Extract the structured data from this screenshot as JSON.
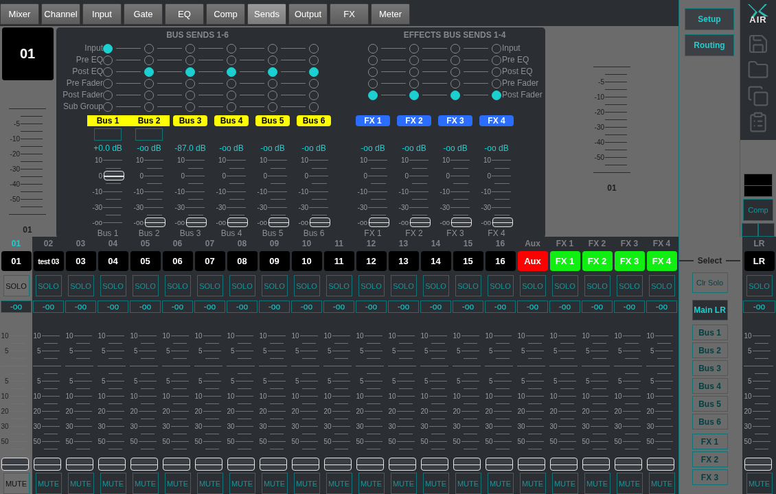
{
  "tabs": [
    {
      "label": "Mixer",
      "selected": false
    },
    {
      "label": "Channel",
      "selected": false
    },
    {
      "label": "Input",
      "selected": false
    },
    {
      "label": "Gate",
      "selected": false
    },
    {
      "label": "EQ",
      "selected": false
    },
    {
      "label": "Comp",
      "selected": false
    },
    {
      "label": "Sends",
      "selected": true
    },
    {
      "label": "Output",
      "selected": false
    },
    {
      "label": "FX",
      "selected": false
    },
    {
      "label": "Meter",
      "selected": false
    }
  ],
  "channel_header": {
    "name": "01",
    "scale": [
      "-5",
      "-10",
      "-20",
      "-30",
      "-40",
      "-50"
    ],
    "label": "01"
  },
  "bus_sends": {
    "title": "BUS SENDS 1-6",
    "tap_labels": [
      "Input",
      "Pre EQ",
      "Post EQ",
      "Pre Fader",
      "Post Fader",
      "Sub Group"
    ],
    "buses": [
      {
        "name": "Bus 1",
        "color": "#ffff00",
        "linked": true,
        "taps": [
          {
            "selected": true
          },
          {
            "selected": false
          },
          {
            "selected": false
          },
          {
            "selected": false
          },
          {
            "selected": false
          },
          {
            "selected": false
          }
        ],
        "reading": "+0.0 dB",
        "scale": [
          "10",
          "0",
          "-10",
          "-30",
          "-oo"
        ],
        "level": 0.76,
        "footer": "Bus 1"
      },
      {
        "name": "Bus 2",
        "color": "#ffff00",
        "linked": true,
        "taps": [
          {
            "selected": false
          },
          {
            "selected": false
          },
          {
            "selected": true
          },
          {
            "selected": false
          },
          {
            "selected": false
          },
          {
            "selected": false
          }
        ],
        "reading": "-oo dB",
        "scale": [
          "10",
          "0",
          "-10",
          "-30",
          "-oo"
        ],
        "level": 0,
        "footer": "Bus 2"
      },
      {
        "name": "Bus 3",
        "color": "#ffff00",
        "linked": false,
        "taps": [
          {
            "selected": false
          },
          {
            "selected": false
          },
          {
            "selected": true
          },
          {
            "selected": false
          },
          {
            "selected": false
          },
          {
            "selected": false
          }
        ],
        "reading": "-87.0 dB",
        "scale": [
          "10",
          "0",
          "-10",
          "-30",
          "-oo"
        ],
        "level": 0,
        "footer": "Bus 3"
      },
      {
        "name": "Bus 4",
        "color": "#ffff00",
        "linked": false,
        "taps": [
          {
            "selected": false
          },
          {
            "selected": false
          },
          {
            "selected": true
          },
          {
            "selected": false
          },
          {
            "selected": false
          },
          {
            "selected": false
          }
        ],
        "reading": "-oo dB",
        "scale": [
          "10",
          "0",
          "-10",
          "-30",
          "-oo"
        ],
        "level": 0,
        "footer": "Bus 4"
      },
      {
        "name": "Bus 5",
        "color": "#ffff00",
        "linked": false,
        "taps": [
          {
            "selected": false
          },
          {
            "selected": false
          },
          {
            "selected": true
          },
          {
            "selected": false
          },
          {
            "selected": false
          },
          {
            "selected": false
          }
        ],
        "reading": "-oo dB",
        "scale": [
          "10",
          "0",
          "-10",
          "-30",
          "-oo"
        ],
        "level": 0,
        "footer": "Bus 5"
      },
      {
        "name": "Bus 6",
        "color": "#ffff00",
        "linked": false,
        "taps": [
          {
            "selected": false
          },
          {
            "selected": false
          },
          {
            "selected": true
          },
          {
            "selected": false
          },
          {
            "selected": false
          },
          {
            "selected": false
          }
        ],
        "reading": "-oo dB",
        "scale": [
          "10",
          "0",
          "-10",
          "-30",
          "-oo"
        ],
        "level": 0,
        "footer": "Bus 6"
      }
    ]
  },
  "effects_sends": {
    "title": "EFFECTS BUS SENDS 1-4",
    "tap_labels": [
      "Input",
      "Pre EQ",
      "Post EQ",
      "Pre Fader",
      "Post Fader"
    ],
    "buses": [
      {
        "name": "FX 1",
        "color": "#2a6dff",
        "linked": false,
        "taps": [
          {
            "selected": false
          },
          {
            "selected": false
          },
          {
            "selected": false
          },
          {
            "selected": false
          },
          {
            "selected": true
          }
        ],
        "reading": "-oo dB",
        "scale": [
          "10",
          "0",
          "-10",
          "-30",
          "-oo"
        ],
        "level": 0,
        "footer": "FX 1"
      },
      {
        "name": "FX 2",
        "color": "#2a6dff",
        "linked": false,
        "taps": [
          {
            "selected": false
          },
          {
            "selected": false
          },
          {
            "selected": false
          },
          {
            "selected": false
          },
          {
            "selected": true
          }
        ],
        "reading": "-oo dB",
        "scale": [
          "10",
          "0",
          "-10",
          "-30",
          "-oo"
        ],
        "level": 0,
        "footer": "FX 2"
      },
      {
        "name": "FX 3",
        "color": "#2a6dff",
        "linked": false,
        "taps": [
          {
            "selected": false
          },
          {
            "selected": false
          },
          {
            "selected": false
          },
          {
            "selected": false
          },
          {
            "selected": true
          }
        ],
        "reading": "-oo dB",
        "scale": [
          "10",
          "0",
          "-10",
          "-30",
          "-oo"
        ],
        "level": 0,
        "footer": "FX 3"
      },
      {
        "name": "FX 4",
        "color": "#2a6dff",
        "linked": false,
        "taps": [
          {
            "selected": false
          },
          {
            "selected": false
          },
          {
            "selected": false
          },
          {
            "selected": false
          },
          {
            "selected": true
          }
        ],
        "reading": "-oo dB",
        "scale": [
          "10",
          "0",
          "-10",
          "-30",
          "-oo"
        ],
        "level": 0,
        "footer": "FX 4"
      }
    ]
  },
  "meter_panel": {
    "scale": [
      "-5",
      "-10",
      "-20",
      "-30",
      "-40",
      "-50"
    ],
    "label": "01"
  },
  "side_buttons": [
    "Setup",
    "Routing"
  ],
  "logo": "AIR",
  "comp_button": "Comp",
  "channels": [
    {
      "number": "01",
      "name": "01",
      "color": "#000000",
      "selected": true,
      "solo": "SOLO",
      "reading": "-oo",
      "scale": [
        "10",
        "5",
        "5",
        "10",
        "20",
        "30",
        "50"
      ],
      "level": 0,
      "mute": "MUTE"
    },
    {
      "number": "02",
      "name": "test 03",
      "color": "#000000",
      "selected": false,
      "solo": "SOLO",
      "reading": "-oo",
      "scale": [
        "10",
        "5",
        "5",
        "10",
        "20",
        "30",
        "50"
      ],
      "level": 0,
      "mute": "MUTE"
    },
    {
      "number": "03",
      "name": "03",
      "color": "#000000",
      "selected": false,
      "solo": "SOLO",
      "reading": "-oo",
      "scale": [
        "10",
        "5",
        "5",
        "10",
        "20",
        "30",
        "50"
      ],
      "level": 0,
      "mute": "MUTE"
    },
    {
      "number": "04",
      "name": "04",
      "color": "#000000",
      "selected": false,
      "solo": "SOLO",
      "reading": "-oo",
      "scale": [
        "10",
        "5",
        "5",
        "10",
        "20",
        "30",
        "50"
      ],
      "level": 0,
      "mute": "MUTE"
    },
    {
      "number": "05",
      "name": "05",
      "color": "#000000",
      "selected": false,
      "solo": "SOLO",
      "reading": "-oo",
      "scale": [
        "10",
        "5",
        "5",
        "10",
        "20",
        "30",
        "50"
      ],
      "level": 0,
      "mute": "MUTE"
    },
    {
      "number": "06",
      "name": "06",
      "color": "#000000",
      "selected": false,
      "solo": "SOLO",
      "reading": "-oo",
      "scale": [
        "10",
        "5",
        "5",
        "10",
        "20",
        "30",
        "50"
      ],
      "level": 0,
      "mute": "MUTE"
    },
    {
      "number": "07",
      "name": "07",
      "color": "#000000",
      "selected": false,
      "solo": "SOLO",
      "reading": "-oo",
      "scale": [
        "10",
        "5",
        "5",
        "10",
        "20",
        "30",
        "50"
      ],
      "level": 0,
      "mute": "MUTE"
    },
    {
      "number": "08",
      "name": "08",
      "color": "#000000",
      "selected": false,
      "solo": "SOLO",
      "reading": "-oo",
      "scale": [
        "10",
        "5",
        "5",
        "10",
        "20",
        "30",
        "50"
      ],
      "level": 0,
      "mute": "MUTE"
    },
    {
      "number": "09",
      "name": "09",
      "color": "#000000",
      "selected": false,
      "solo": "SOLO",
      "reading": "-oo",
      "scale": [
        "10",
        "5",
        "5",
        "10",
        "20",
        "30",
        "50"
      ],
      "level": 0,
      "mute": "MUTE"
    },
    {
      "number": "10",
      "name": "10",
      "color": "#000000",
      "selected": false,
      "solo": "SOLO",
      "reading": "-oo",
      "scale": [
        "10",
        "5",
        "5",
        "10",
        "20",
        "30",
        "50"
      ],
      "level": 0,
      "mute": "MUTE"
    },
    {
      "number": "11",
      "name": "11",
      "color": "#000000",
      "selected": false,
      "solo": "SOLO",
      "reading": "-oo",
      "scale": [
        "10",
        "5",
        "5",
        "10",
        "20",
        "30",
        "50"
      ],
      "level": 0,
      "mute": "MUTE"
    },
    {
      "number": "12",
      "name": "12",
      "color": "#000000",
      "selected": false,
      "solo": "SOLO",
      "reading": "-oo",
      "scale": [
        "10",
        "5",
        "5",
        "10",
        "20",
        "30",
        "50"
      ],
      "level": 0,
      "mute": "MUTE"
    },
    {
      "number": "13",
      "name": "13",
      "color": "#000000",
      "selected": false,
      "solo": "SOLO",
      "reading": "-oo",
      "scale": [
        "10",
        "5",
        "5",
        "10",
        "20",
        "30",
        "50"
      ],
      "level": 0,
      "mute": "MUTE"
    },
    {
      "number": "14",
      "name": "14",
      "color": "#000000",
      "selected": false,
      "solo": "SOLO",
      "reading": "-oo",
      "scale": [
        "10",
        "5",
        "5",
        "10",
        "20",
        "30",
        "50"
      ],
      "level": 0,
      "mute": "MUTE"
    },
    {
      "number": "15",
      "name": "15",
      "color": "#000000",
      "selected": false,
      "solo": "SOLO",
      "reading": "-oo",
      "scale": [
        "10",
        "5",
        "5",
        "10",
        "20",
        "30",
        "50"
      ],
      "level": 0,
      "mute": "MUTE"
    },
    {
      "number": "16",
      "name": "16",
      "color": "#000000",
      "selected": false,
      "solo": "SOLO",
      "reading": "-oo",
      "scale": [
        "10",
        "5",
        "5",
        "10",
        "20",
        "30",
        "50"
      ],
      "level": 0,
      "mute": "MUTE"
    },
    {
      "number": "Aux",
      "name": "Aux",
      "color": "#ff0000",
      "selected": false,
      "solo": "SOLO",
      "reading": "-oo",
      "scale": [
        "10",
        "5",
        "5",
        "10",
        "20",
        "30",
        "50"
      ],
      "level": 0,
      "mute": "MUTE"
    },
    {
      "number": "FX 1",
      "name": "FX 1",
      "color": "#11ee11",
      "selected": false,
      "solo": "SOLO",
      "reading": "-oo",
      "scale": [
        "10",
        "5",
        "5",
        "10",
        "20",
        "30",
        "50"
      ],
      "level": 0,
      "mute": "MUTE"
    },
    {
      "number": "FX 2",
      "name": "FX 2",
      "color": "#11ee11",
      "selected": false,
      "solo": "SOLO",
      "reading": "-oo",
      "scale": [
        "10",
        "5",
        "5",
        "10",
        "20",
        "30",
        "50"
      ],
      "level": 0,
      "mute": "MUTE"
    },
    {
      "number": "FX 3",
      "name": "FX 3",
      "color": "#11ee11",
      "selected": false,
      "solo": "SOLO",
      "reading": "-oo",
      "scale": [
        "10",
        "5",
        "5",
        "10",
        "20",
        "30",
        "50"
      ],
      "level": 0,
      "mute": "MUTE"
    },
    {
      "number": "FX 4",
      "name": "FX 4",
      "color": "#11ee11",
      "selected": false,
      "solo": "SOLO",
      "reading": "-oo",
      "scale": [
        "10",
        "5",
        "5",
        "10",
        "20",
        "30",
        "50"
      ],
      "level": 0,
      "mute": "MUTE"
    }
  ],
  "select_panel": {
    "title": "Select",
    "clear": "Clr Solo",
    "groups": [
      {
        "items": [
          {
            "label": "Main LR",
            "selected": true
          }
        ]
      },
      {
        "items": [
          {
            "label": "Bus 1",
            "selected": false
          },
          {
            "label": "Bus 2",
            "selected": false
          },
          {
            "label": "Bus 3",
            "selected": false
          },
          {
            "label": "Bus 4",
            "selected": false
          },
          {
            "label": "Bus 5",
            "selected": false
          },
          {
            "label": "Bus 6",
            "selected": false
          }
        ]
      },
      {
        "items": [
          {
            "label": "FX 1",
            "selected": false
          },
          {
            "label": "FX 2",
            "selected": false
          },
          {
            "label": "FX 3",
            "selected": false
          }
        ]
      }
    ]
  },
  "main_strip": {
    "number": "LR",
    "name": "LR",
    "color": "#000000",
    "selected": false,
    "solo": "SOLO",
    "reading": "-oo",
    "scale": [
      "10",
      "5",
      "5",
      "10",
      "20",
      "30",
      "50"
    ],
    "level": 0,
    "mute": "MUTE"
  }
}
